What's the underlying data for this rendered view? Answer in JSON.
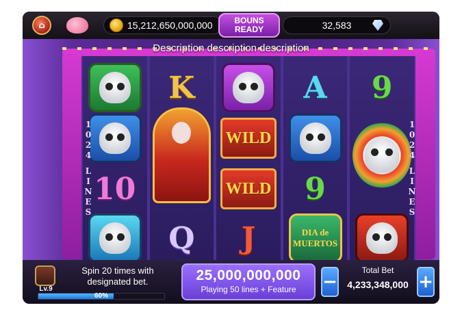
{
  "topbar": {
    "coins": "15,212,650,000,000",
    "bonus_line1": "BOUNS",
    "bonus_line2": "READY",
    "gems": "32,583"
  },
  "description": "Description description description",
  "lines_label_chars": [
    "1",
    "0",
    "2",
    "4",
    "L",
    "I",
    "N",
    "E",
    "S"
  ],
  "reels": [
    [
      "skull-mariachi-green",
      "skull-guitar-blue",
      "10",
      "skull-trumpet"
    ],
    [
      "K",
      "catrina-woman",
      "Q"
    ],
    [
      "skull-maracas",
      "WILD",
      "WILD",
      "J"
    ],
    [
      "A",
      "skull-guitar-blue",
      "9",
      "DIA de MUERTOS"
    ],
    [
      "9",
      "sugar-skull",
      "skull-sombrero"
    ]
  ],
  "mission": {
    "text_line1": "Spin 20 times with",
    "text_line2": "designated bet.",
    "level": "Lv.9",
    "progress_percent": 60,
    "progress_label": "60%"
  },
  "spin": {
    "amount": "25,000,000,000",
    "subtitle": "Playing 50 lines + Feature"
  },
  "bet": {
    "label": "Total Bet",
    "value": "4,233,348,000",
    "minus": "−",
    "plus": "+"
  },
  "colors": {
    "frame": "#d63ad2",
    "spin_button": "#7a4fe6",
    "bet_buttons": "#2f7ae5"
  }
}
